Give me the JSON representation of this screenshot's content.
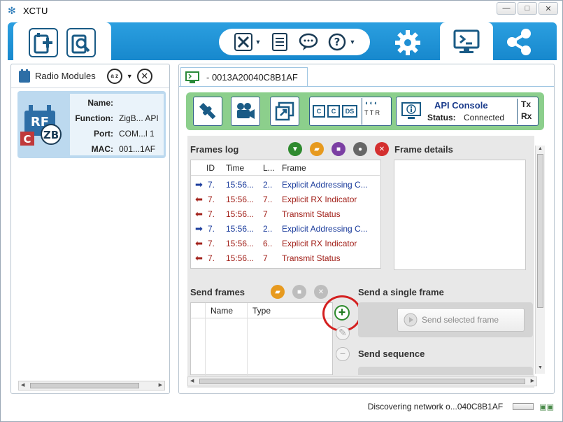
{
  "window": {
    "title": "XCTU",
    "minimize": "—",
    "restore": "□",
    "close": "✕"
  },
  "toolbar": {
    "add_device_icon": "add-radio-icon",
    "discover_icon": "discover-radio-icon",
    "tools_icon": "tools-icon",
    "list_icon": "profile-list-icon",
    "feedback_icon": "feedback-bubble-icon",
    "help_icon": "help-icon",
    "configuration_icon": "gear-icon",
    "console_icon": "console-icon",
    "network_icon": "network-icon"
  },
  "left_panel": {
    "title": "Radio Modules",
    "sort_label": "a z",
    "module": {
      "badge_rf": "RF",
      "badge_zb": "ZB",
      "badge_c": "C",
      "fields": [
        {
          "k": "Name:",
          "v": ""
        },
        {
          "k": "Function:",
          "v": "ZigB... API"
        },
        {
          "k": "Port:",
          "v": "COM...l 1"
        },
        {
          "k": "MAC:",
          "v": "001...1AF"
        }
      ]
    }
  },
  "console": {
    "tab_label": "- 0013A20040C8B1AF",
    "api_title": "API Console",
    "status_label": "Status:",
    "status_value": "Connected",
    "tx": "Tx",
    "rx": "Rx",
    "frames_log_title": "Frames log",
    "frame_details_title": "Frame details",
    "columns": [
      "ID",
      "Time",
      "L...",
      "Frame"
    ],
    "rows": [
      {
        "dir": "out",
        "id": "7.",
        "time": "15:56...",
        "len": "2..",
        "frame": "Explicit Addressing C..."
      },
      {
        "dir": "in",
        "id": "7.",
        "time": "15:56...",
        "len": "7..",
        "frame": "Explicit RX Indicator"
      },
      {
        "dir": "in",
        "id": "7.",
        "time": "15:56...",
        "len": "7",
        "frame": "Transmit Status"
      },
      {
        "dir": "out",
        "id": "7.",
        "time": "15:56...",
        "len": "2..",
        "frame": "Explicit Addressing C..."
      },
      {
        "dir": "in",
        "id": "7.",
        "time": "15:56...",
        "len": "6..",
        "frame": "Explicit RX Indicator"
      },
      {
        "dir": "in",
        "id": "7.",
        "time": "15:56...",
        "len": "7",
        "frame": "Transmit Status"
      }
    ],
    "send_frames_title": "Send frames",
    "send_columns": [
      "Name",
      "Type"
    ],
    "single_frame_title": "Send a single frame",
    "send_selected_label": "Send selected frame",
    "sequence_title": "Send sequence",
    "ds_labels": [
      "C",
      "C",
      "DS"
    ],
    "mini_labels": [
      "T",
      "T",
      "R"
    ]
  },
  "status": {
    "text": "Discovering network o...040C8B1AF"
  },
  "colors": {
    "band": "#1e8fd4",
    "green_bar": "#8ccf8c",
    "highlight_ring": "#d42020"
  }
}
